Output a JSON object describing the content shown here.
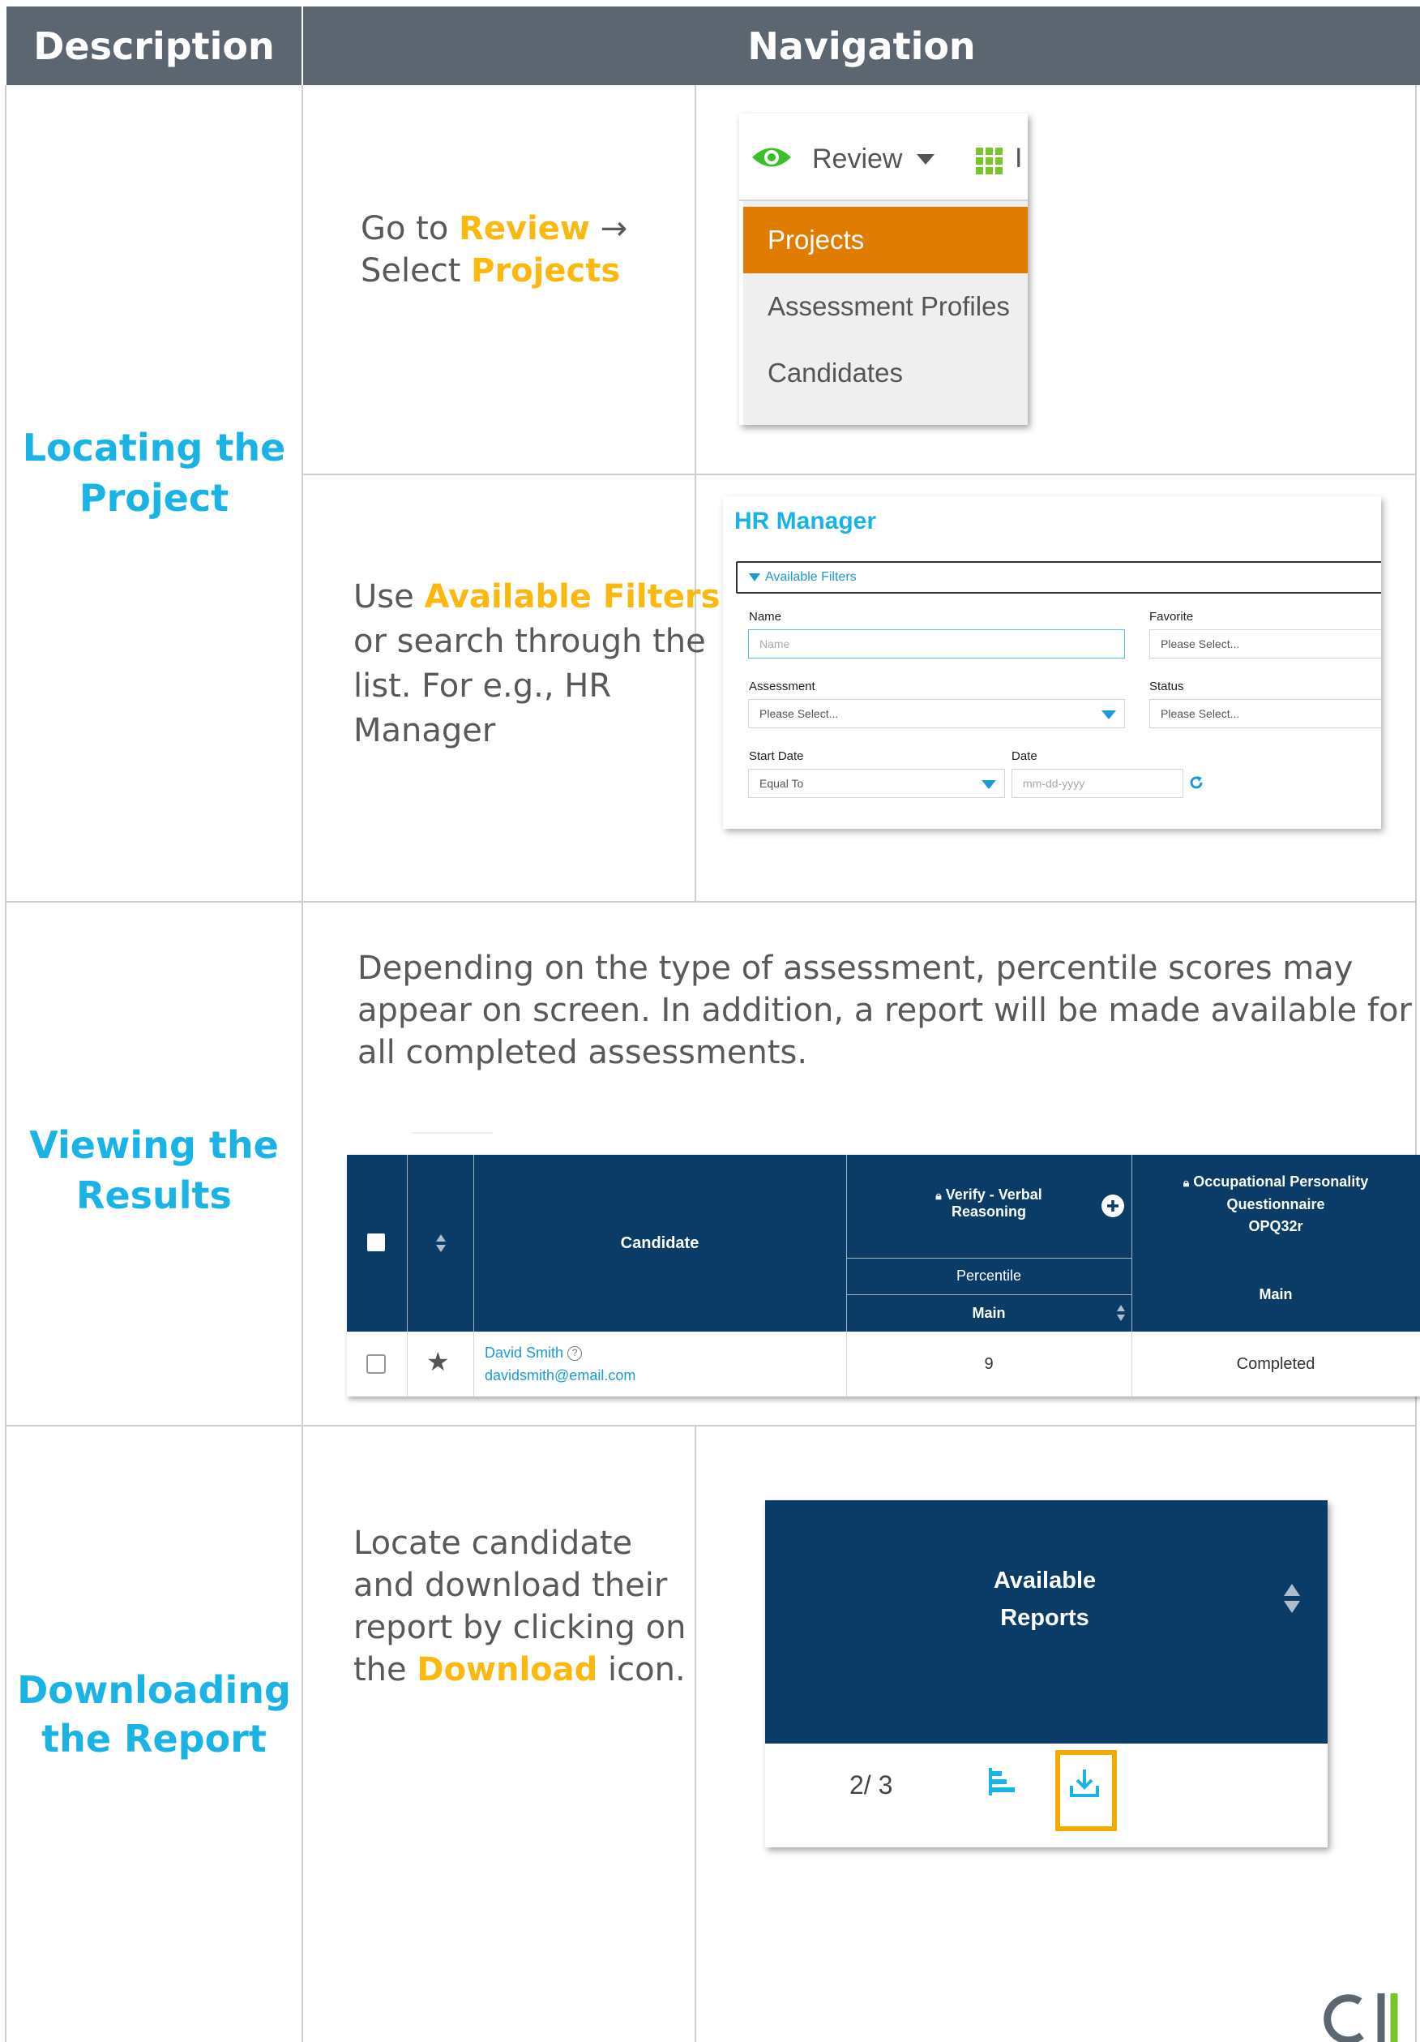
{
  "header": {
    "col1": "Description",
    "col2": "Navigation"
  },
  "sections": {
    "locating": {
      "label_line1": "Locating the",
      "label_line2": "Project",
      "step1": {
        "t1": "Go to ",
        "h1": "Review",
        "t2": "  →",
        "t3": "Select ",
        "h2": "Projects"
      },
      "step2": {
        "t1": "Use ",
        "h1": "Available Filters",
        "l2": "or search through the",
        "l3": "list. For e.g., HR",
        "l4": "Manager"
      }
    },
    "viewing": {
      "label_line1": "Viewing the",
      "label_line2": "Results",
      "l1": "Depending on the type of assessment, percentile scores may",
      "l2": "appear on screen. In addition, a report will be made available for",
      "l3": "all completed assessments."
    },
    "downloading": {
      "label_line1": "Downloading",
      "label_line2": "the Report",
      "l1": "Locate candidate",
      "l2": "and download their",
      "l3": "report by clicking on",
      "h1": "Download",
      "t4": " icon.",
      "t4pre": "the "
    }
  },
  "review_menu": {
    "title": "Review",
    "items": [
      "Projects",
      "Assessment Profiles",
      "Candidates"
    ],
    "active_item": "Projects",
    "accent": "#e07c00"
  },
  "hr_panel": {
    "title": "HR Manager",
    "filters_label": "Available Filters",
    "name_label": "Name",
    "name_placeholder": "Name",
    "favorite_label": "Favorite",
    "favorite_value": "Please Select...",
    "assessment_label": "Assessment",
    "assessment_value": "Please Select...",
    "status_label": "Status",
    "status_value": "Please Select...",
    "start_date_label": "Start Date",
    "start_date_value": "Equal To",
    "date_label": "Date",
    "date_placeholder": "mm-dd-yyyy"
  },
  "results_table": {
    "candidate_header": "Candidate",
    "col1_title_l1": "Verify - Verbal",
    "col1_title_l2": "Reasoning",
    "col1_sub": "Percentile",
    "col1_sub2": "Main",
    "col2_title_l1": "Occupational Personality",
    "col2_title_l2": "Questionnaire",
    "col2_title_l3": "OPQ32r",
    "col2_sub": "Main",
    "row": {
      "name": "David Smith",
      "email": "davidsmith@email.com",
      "score": "9",
      "status": "Completed"
    },
    "header_color": "#0b3c67"
  },
  "reports_panel": {
    "title_l1": "Available",
    "title_l2": "Reports",
    "count": "2/ 3",
    "highlight_color": "#f5a800"
  },
  "icons": [
    "eye-icon",
    "grid-icon",
    "caret-down-icon",
    "refresh-icon",
    "lock-icon",
    "plus-circle-icon",
    "sort-icon",
    "star-icon",
    "help-icon",
    "bar-chart-icon",
    "download-icon"
  ]
}
